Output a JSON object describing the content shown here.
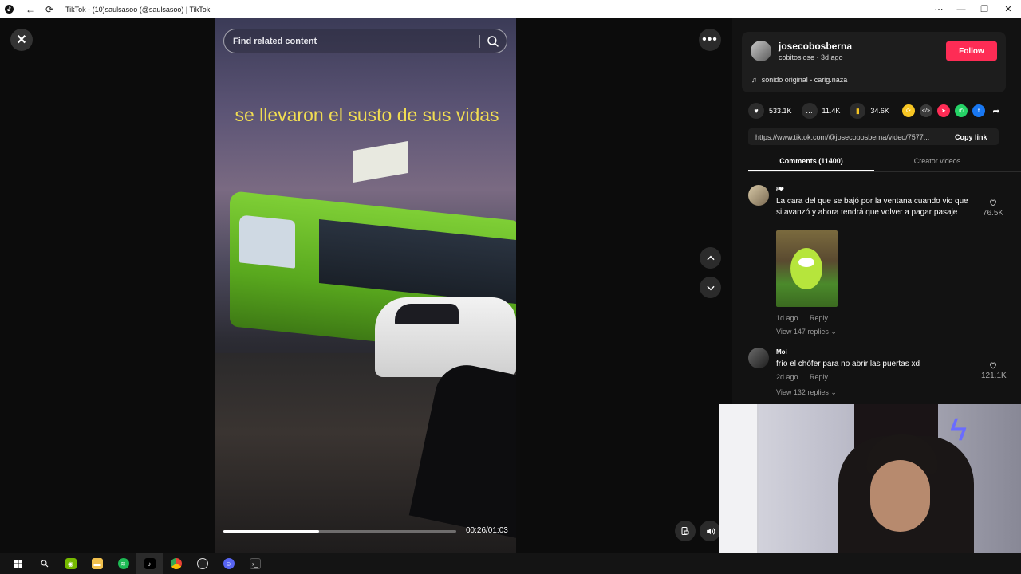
{
  "window": {
    "title": "TikTok - (10)saulsasoo (@saulsasoo) | TikTok",
    "app_icon": "tiktok-logo-icon",
    "back_icon": "arrow-left-icon",
    "reload_icon": "reload-icon"
  },
  "video": {
    "search_placeholder": "Find related content",
    "caption": "se llevaron el susto de sus vidas",
    "time": "00:26/01:03",
    "progress": 0.41
  },
  "author": {
    "username": "josecobosberna",
    "meta": "cobitosjose · 3d ago",
    "follow_label": "Follow",
    "music": "sonido original - carig.naza"
  },
  "stats": {
    "likes": "533.1K",
    "comments": "11.4K",
    "saves": "34.6K"
  },
  "share": {
    "url": "https://www.tiktok.com/@josecobosberna/video/7577...",
    "copy_label": "Copy link"
  },
  "tabs": [
    {
      "label": "Comments (11400)",
      "active": true
    },
    {
      "label": "Creator videos",
      "active": false
    }
  ],
  "comments": [
    {
      "user": "ᶳ❤",
      "text": "La cara del que se bajó por la ventana cuando vio que si avanzó y ahora tendrá que volver a pagar pasaje",
      "likes": "76.5K",
      "time": "1d ago",
      "reply_label": "Reply",
      "replies": "View 147 replies ⌄"
    },
    {
      "user": "Moi",
      "text": "frío el chófer para no abrir las puertas xd",
      "likes": "121.1K",
      "time": "2d ago",
      "reply_label": "Reply",
      "replies": "View 132 replies ⌄"
    }
  ],
  "colors": {
    "accent": "#fe2c55",
    "caption": "#f1dd52",
    "panel_bg": "#121212"
  },
  "taskbar": {
    "items": [
      "windows-start-icon",
      "search-icon",
      "nvidia-icon",
      "file-explorer-icon",
      "spotify-icon",
      "tiktok-icon",
      "chrome-icon",
      "obs-icon",
      "discord-icon",
      "terminal-icon"
    ]
  }
}
